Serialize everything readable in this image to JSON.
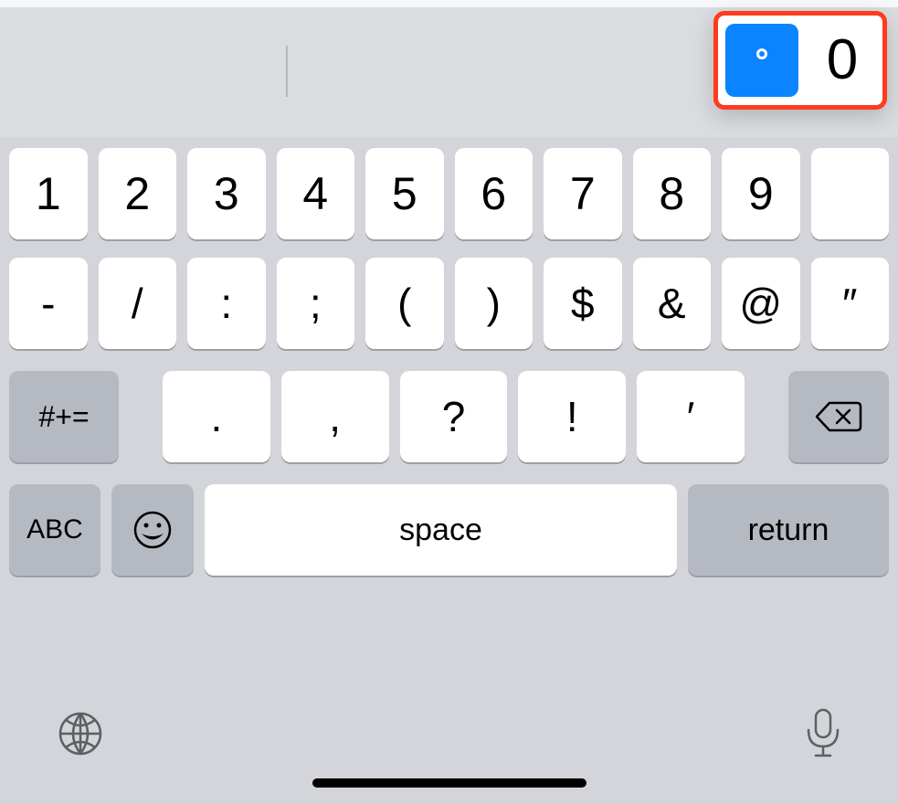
{
  "popup": {
    "character": "0"
  },
  "row1": [
    "1",
    "2",
    "3",
    "4",
    "5",
    "6",
    "7",
    "8",
    "9",
    ""
  ],
  "row2": [
    "-",
    "/",
    ":",
    ";",
    "(",
    ")",
    "$",
    "&",
    "@",
    "″"
  ],
  "row3_mod": "#+=",
  "row3": [
    ".",
    ",",
    "?",
    "!",
    "′"
  ],
  "row4": {
    "abc": "ABC",
    "space": "space",
    "return": "return"
  }
}
